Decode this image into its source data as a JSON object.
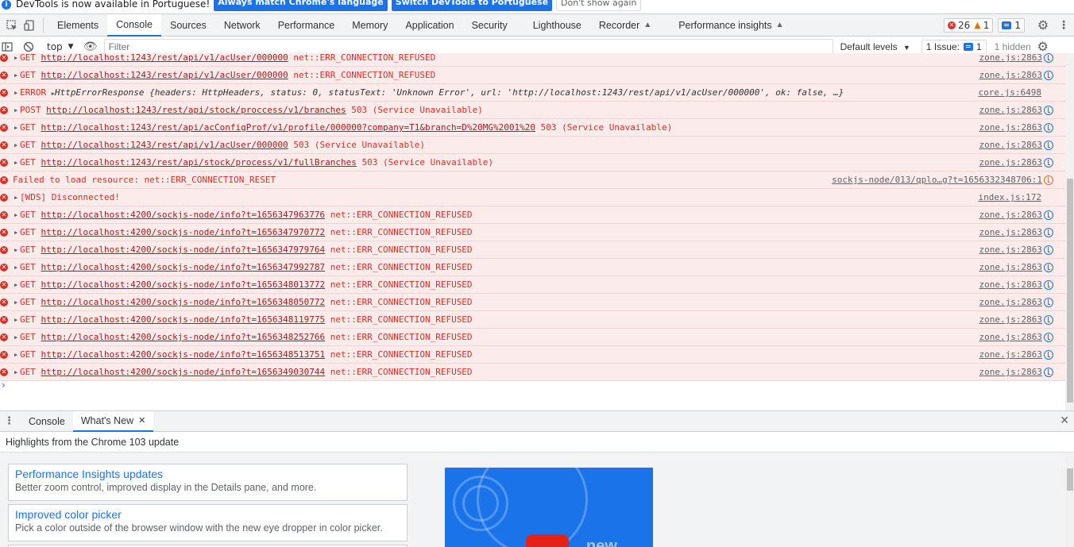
{
  "infobar": {
    "message": "DevTools is now available in Portuguese!",
    "btn_match": "Always match Chrome's language",
    "btn_switch": "Switch DevTools to Portuguese",
    "btn_dismiss": "Don't show again"
  },
  "tabs": [
    "Elements",
    "Console",
    "Sources",
    "Network",
    "Performance",
    "Memory",
    "Application",
    "Security",
    "Lighthouse",
    "Recorder",
    "Performance insights"
  ],
  "active_tab": "Console",
  "counts": {
    "errors": "26",
    "warnings": "1",
    "messages": "1"
  },
  "toolbar": {
    "context": "top",
    "filter_placeholder": "Filter",
    "levels": "Default levels",
    "issues": "1 Issue:",
    "issues_count": "1",
    "hidden": "1 hidden"
  },
  "log": [
    {
      "method": "GET",
      "url": "http://localhost:1243/rest/api/v1/acUser/000000",
      "tail": " net::ERR_CONNECTION_REFUSED",
      "source": "zone.js:2863"
    },
    {
      "method": "GET",
      "url": "http://localhost:1243/rest/api/v1/acUser/000000",
      "tail": " net::ERR_CONNECTION_REFUSED",
      "source": "zone.js:2863"
    },
    {
      "method": "ERROR",
      "obj": "HttpErrorResponse {headers: HttpHeaders, status: 0, statusText: 'Unknown Error', url: 'http://localhost:1243/rest/api/v1/acUser/000000', ok: false, …}",
      "source": "core.js:6498"
    },
    {
      "method": "POST",
      "url": "http://localhost:1243/rest/api/stock/proccess/v1/branches",
      "tail": " 503 (Service Unavailable)",
      "source": "zone.js:2863"
    },
    {
      "method": "GET",
      "url": "http://localhost:1243/rest/api/acConfigProf/v1/profile/000000?company=T1&branch=D%20MG%2001%20",
      "tail": " 503 (Service Unavailable)",
      "source": "zone.js:2863"
    },
    {
      "method": "GET",
      "url": "http://localhost:1243/rest/api/v1/acUser/000000",
      "tail": " 503 (Service Unavailable)",
      "source": "zone.js:2863"
    },
    {
      "method": "GET",
      "url": "http://localhost:1243/rest/api/stock/process/v1/fullBranches",
      "tail": " 503 (Service Unavailable)",
      "source": "zone.js:2863"
    },
    {
      "method": "",
      "text": "Failed to load resource: net::ERR_CONNECTION_RESET",
      "source": "sockjs-node/013/qplo…g?t=1656332348706:1"
    },
    {
      "method": "[WDS]",
      "text": "Disconnected!",
      "source": "index.js:172"
    },
    {
      "method": "GET",
      "url": "http://localhost:4200/sockjs-node/info?t=1656347963776",
      "tail": " net::ERR_CONNECTION_REFUSED",
      "source": "zone.js:2863"
    },
    {
      "method": "GET",
      "url": "http://localhost:4200/sockjs-node/info?t=1656347970772",
      "tail": " net::ERR_CONNECTION_REFUSED",
      "source": "zone.js:2863"
    },
    {
      "method": "GET",
      "url": "http://localhost:4200/sockjs-node/info?t=1656347979764",
      "tail": " net::ERR_CONNECTION_REFUSED",
      "source": "zone.js:2863"
    },
    {
      "method": "GET",
      "url": "http://localhost:4200/sockjs-node/info?t=1656347992787",
      "tail": " net::ERR_CONNECTION_REFUSED",
      "source": "zone.js:2863"
    },
    {
      "method": "GET",
      "url": "http://localhost:4200/sockjs-node/info?t=1656348013772",
      "tail": " net::ERR_CONNECTION_REFUSED",
      "source": "zone.js:2863"
    },
    {
      "method": "GET",
      "url": "http://localhost:4200/sockjs-node/info?t=1656348050772",
      "tail": " net::ERR_CONNECTION_REFUSED",
      "source": "zone.js:2863"
    },
    {
      "method": "GET",
      "url": "http://localhost:4200/sockjs-node/info?t=1656348119775",
      "tail": " net::ERR_CONNECTION_REFUSED",
      "source": "zone.js:2863"
    },
    {
      "method": "GET",
      "url": "http://localhost:4200/sockjs-node/info?t=1656348252766",
      "tail": " net::ERR_CONNECTION_REFUSED",
      "source": "zone.js:2863"
    },
    {
      "method": "GET",
      "url": "http://localhost:4200/sockjs-node/info?t=1656348513751",
      "tail": " net::ERR_CONNECTION_REFUSED",
      "source": "zone.js:2863"
    },
    {
      "method": "GET",
      "url": "http://localhost:4200/sockjs-node/info?t=1656349030744",
      "tail": " net::ERR_CONNECTION_REFUSED",
      "source": "zone.js:2863"
    }
  ],
  "drawer": {
    "tab_console": "Console",
    "tab_whats_new": "What's New",
    "highlights": "Highlights from the Chrome 103 update",
    "cards": [
      {
        "title": "Performance Insights updates",
        "desc": "Better zoom control, improved display in the Details pane, and more."
      },
      {
        "title": "Improved color picker",
        "desc": "Pick a color outside of the browser window with the new eye dropper in color picker."
      }
    ],
    "video_word": "new"
  },
  "colors": {
    "accent": "#1a73e8",
    "error_text": "#d93025",
    "error_bg": "#fcebeb"
  }
}
